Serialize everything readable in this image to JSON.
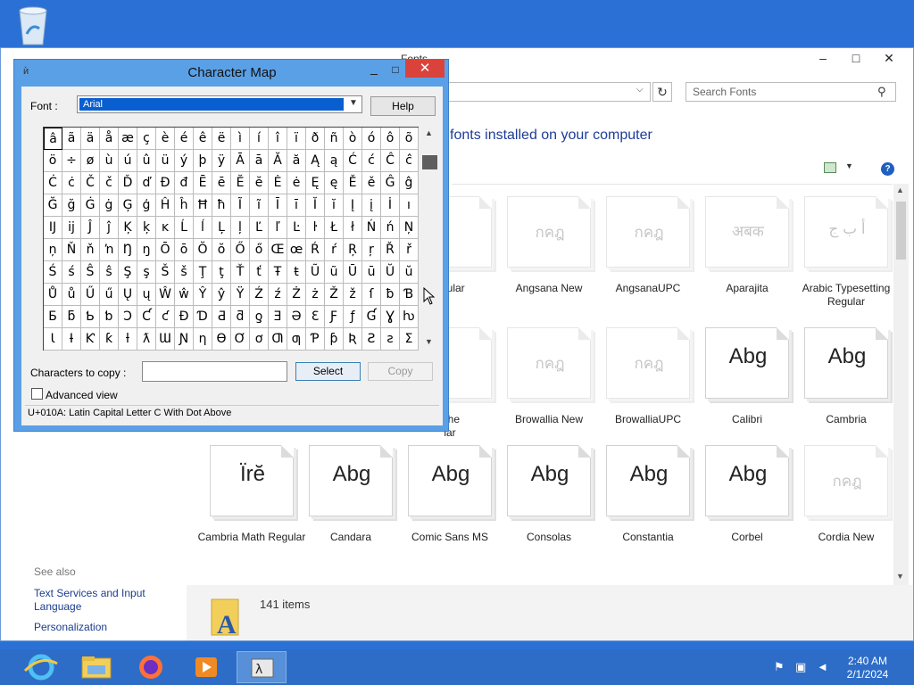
{
  "desktop": {
    "recycle_bin_icon": "recycle-bin-icon"
  },
  "fonts_window": {
    "title": "Fonts",
    "address_chevron": "⌵",
    "search_placeholder": "Search Fonts",
    "headline": "fonts installed on your computer",
    "item_count": "141 items",
    "see_also": "See also",
    "links": [
      "Text Services and Input Language",
      "Personalization"
    ],
    "fonts": [
      {
        "name": "egular",
        "glyph": "",
        "faint": true
      },
      {
        "name": "Angsana New",
        "glyph": "กคฎ",
        "faint": true
      },
      {
        "name": "AngsanaUPC",
        "glyph": "กคฎ",
        "faint": true
      },
      {
        "name": "Aparajita",
        "glyph": "अबक",
        "faint": true
      },
      {
        "name": "Arabic Typesetting Regular",
        "glyph": "أ ب ج",
        "faint": true
      },
      {
        "name": "Che\nlar",
        "glyph": "",
        "faint": true
      },
      {
        "name": "Browallia New",
        "glyph": "กคฎ",
        "faint": true
      },
      {
        "name": "BrowalliaUPC",
        "glyph": "กคฎ",
        "faint": true
      },
      {
        "name": "Calibri",
        "glyph": "Abg",
        "faint": false
      },
      {
        "name": "Cambria",
        "glyph": "Abg",
        "faint": false
      },
      {
        "name": "Cambria Math Regular",
        "glyph": "Ïrĕ",
        "faint": false
      },
      {
        "name": "Candara",
        "glyph": "Abg",
        "faint": false
      },
      {
        "name": "Comic Sans MS",
        "glyph": "Abg",
        "faint": false
      },
      {
        "name": "Consolas",
        "glyph": "Abg",
        "faint": false
      },
      {
        "name": "Constantia",
        "glyph": "Abg",
        "faint": false
      },
      {
        "name": "Corbel",
        "glyph": "Abg",
        "faint": false
      },
      {
        "name": "Cordia New",
        "glyph": "กคฎ",
        "faint": true
      }
    ]
  },
  "charmap": {
    "title": "Character Map",
    "font_label": "Font :",
    "font_value": "Arial",
    "help_button": "Help",
    "rows": [
      "âãäåæçèéêëìíîïðñòóôõ",
      "ö÷øùúûüýþÿĀāĂăĄąĆćĈĉ",
      "ĊċČčĎďĐđĒēĔĕĖėĘęĚěĜĝ",
      "ĞğĠġĢģĤĥĦħĨĩĪīĬĭĮįİı",
      "ĲĳĴĵĶķĸĹĺĻļĽľĿŀŁłŃńŅ",
      "ņŇňŉŊŋŌōŎŏŐőŒœŔŕŖŗŘř",
      "ŚśŜŝŞşŠšŢţŤťŦŧŨũŪūŬŭ",
      "ŮůŰűŲųŴŵŶŷŸŹźŻżŽžſƀƁ",
      "ƂƃƄƅƆƇƈƉƊƋƌƍƎƏƐƑƒƓƔƕ",
      "ƖƗƘƙƚƛƜƝƞƟƠơƢƣƤƥƦƧƨƩ"
    ],
    "selected": {
      "row": 0,
      "col": 0
    },
    "copy_label": "Characters to copy :",
    "copy_value": "",
    "select_button": "Select",
    "copy_button": "Copy",
    "advanced_label": "Advanced view",
    "status": "U+010A: Latin Capital Letter C With Dot Above"
  },
  "taskbar": {
    "apps": [
      "internet-explorer-icon",
      "file-explorer-icon",
      "firefox-icon",
      "media-player-icon",
      "character-map-icon"
    ],
    "time": "2:40 AM",
    "date": "2/1/2024"
  },
  "colors": {
    "desktop": "#2b71d5",
    "close": "#d9433c",
    "selection": "#0a5fd0",
    "link": "#1a3d8f",
    "headline": "#1e3c9b"
  }
}
